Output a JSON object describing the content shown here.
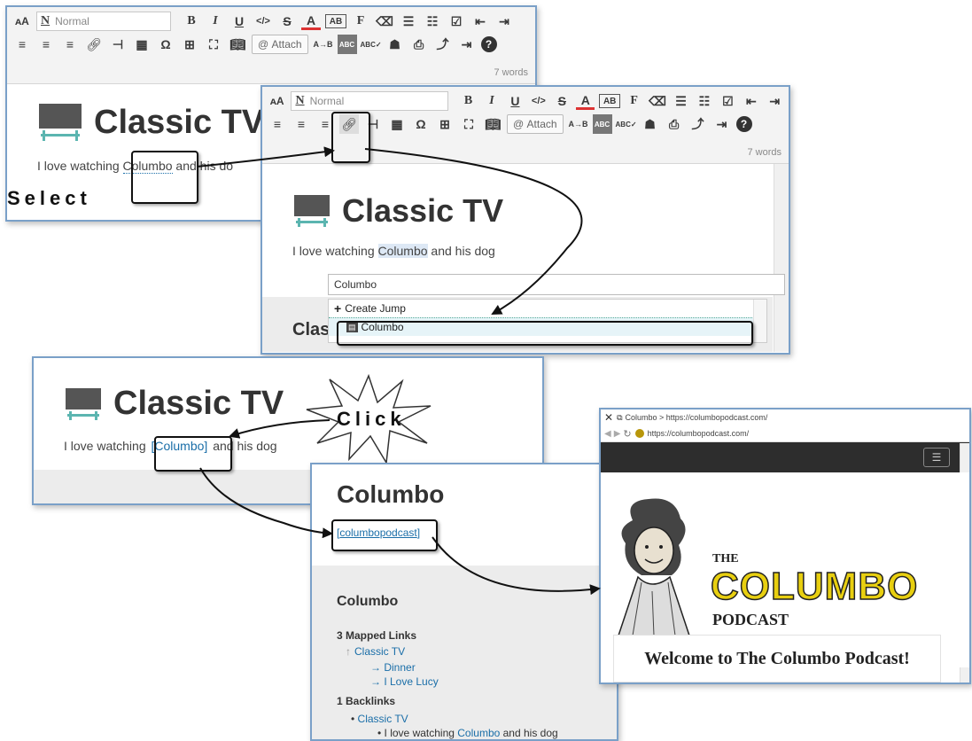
{
  "toolbar": {
    "style_value": "Normal",
    "words": "7 words",
    "attach_label": "Attach"
  },
  "note": {
    "title": "Classic TV",
    "text_before": "I love watching ",
    "link_word": "Columbo",
    "text_after": " and his dog",
    "text_after_panel1": " and his do"
  },
  "labels": {
    "select": "Select",
    "click": "Click"
  },
  "link_popup": {
    "search_value": "Columbo",
    "create_jump": "Create Jump",
    "result": "Columbo",
    "partial_heading": "Clas"
  },
  "columbo_note": {
    "title": "Columbo",
    "link": "columbopodcast",
    "sidebar_title": "Columbo",
    "mapped_heading": "3 Mapped Links",
    "mapped_root": "Classic TV",
    "mapped_children": [
      "Dinner",
      "I Love Lucy"
    ],
    "backlinks_heading": "1 Backlinks",
    "backlink": "Classic TV",
    "backlink_text_before": "I love watching ",
    "backlink_link": "Columbo",
    "backlink_text_after": " and his dog"
  },
  "browser": {
    "tab_title": "Columbo > https://columbopodcast.com/",
    "url": "https://columbopodcast.com/",
    "logo_the": "THE",
    "logo_columbo": "COLUMBO",
    "logo_podcast": "PODCAST",
    "welcome": "Welcome to The Columbo Podcast!",
    "colors": {
      "logo_yellow": "#e8cf10",
      "header_dark": "#2d2d2d"
    }
  }
}
